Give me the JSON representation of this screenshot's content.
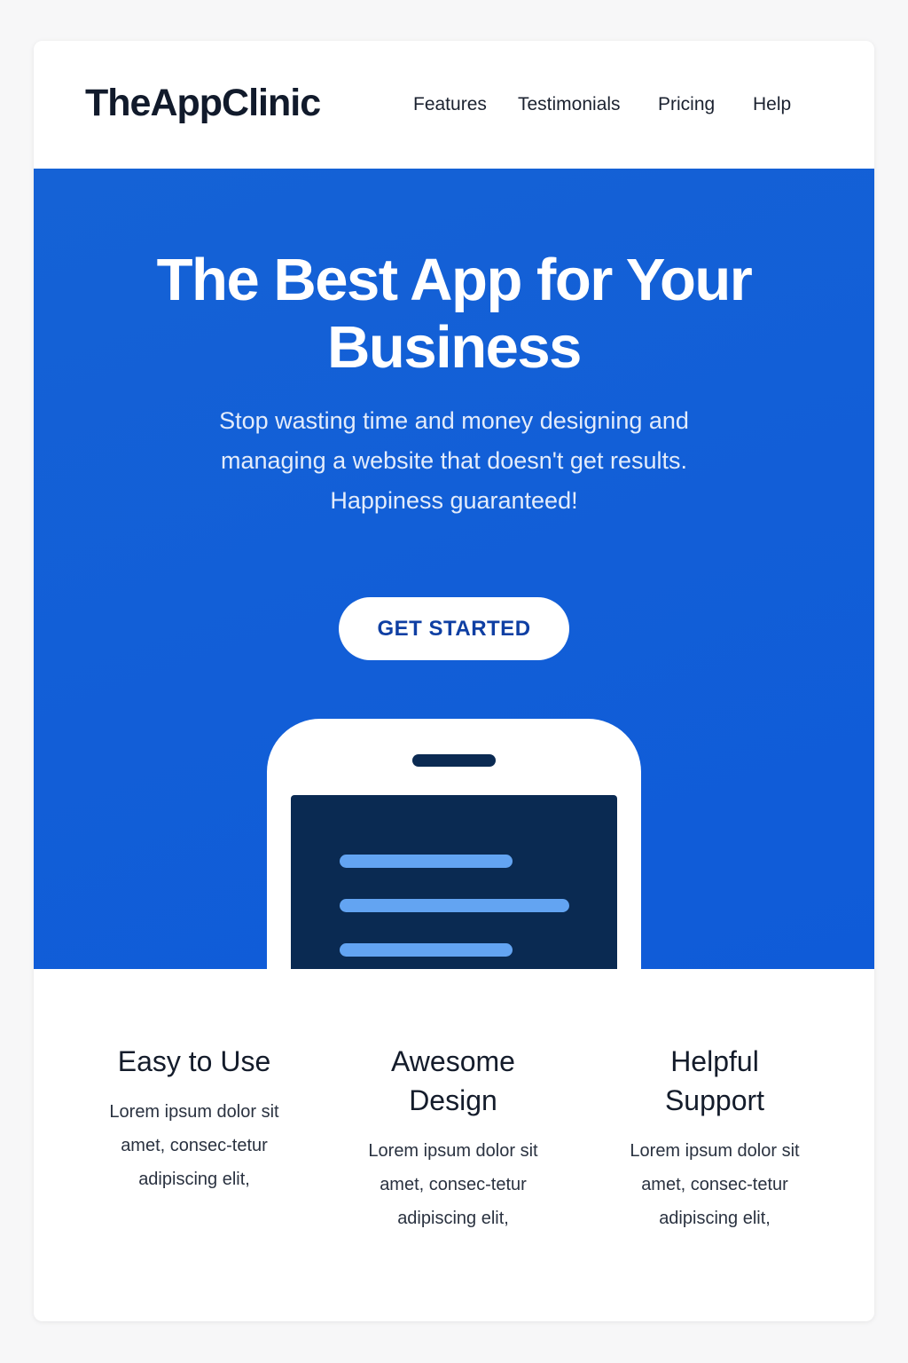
{
  "header": {
    "logo": "TheAppClinic",
    "nav": [
      "Features",
      "Testimonials",
      "Pricing",
      "Help"
    ]
  },
  "hero": {
    "title": "The Best App for Your Business",
    "subtitle": "Stop wasting time and money designing and managing a website that doesn't get results. Happiness guaranteed!",
    "cta_label": "GET STARTED"
  },
  "features": [
    {
      "title": "Easy to Use",
      "text": "Lorem ipsum dolor sit amet, consec-tetur adipiscing elit,"
    },
    {
      "title": "Awesome Design",
      "text": "Lorem ipsum dolor sit amet, consec-tetur adipiscing elit,"
    },
    {
      "title": "Helpful Support",
      "text": "Lorem ipsum dolor sit amet, consec-tetur adipiscing elit,"
    }
  ],
  "icons": [
    "phone-illustration"
  ],
  "colors": {
    "hero_background": "#1060d8",
    "cta_text": "#0f3fa3",
    "phone_screen": "#0a2a52",
    "screen_lines": "#63a4f2"
  }
}
